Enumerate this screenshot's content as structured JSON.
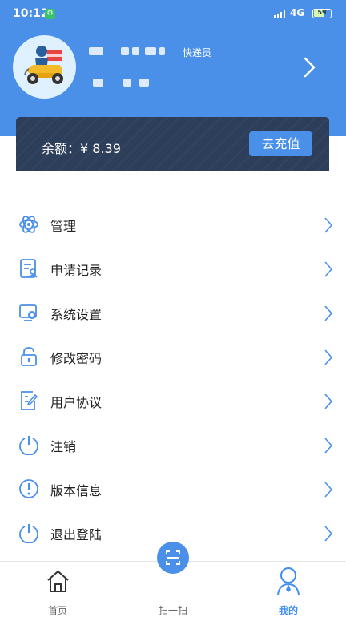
{
  "status_bar": {
    "time": "10:12",
    "app_badge": "⚙",
    "network": "4G",
    "battery": "59"
  },
  "profile": {
    "role": "快递员"
  },
  "balance": {
    "label": "余额：¥ 8.39",
    "recharge_label": "去充值"
  },
  "menu": [
    {
      "label": "管理",
      "icon": "atom-icon"
    },
    {
      "label": "申请记录",
      "icon": "document-user-icon"
    },
    {
      "label": "系统设置",
      "icon": "settings-icon"
    },
    {
      "label": "修改密码",
      "icon": "lock-icon"
    },
    {
      "label": "用户协议",
      "icon": "agreement-edit-icon"
    },
    {
      "label": "注销",
      "icon": "power-icon"
    },
    {
      "label": "版本信息",
      "icon": "info-icon"
    },
    {
      "label": "退出登陆",
      "icon": "logout-power-icon"
    }
  ],
  "nav": {
    "home": "首页",
    "scan": "扫一扫",
    "me": "我的"
  },
  "colors": {
    "primary": "#4a90e8",
    "card": "#2d3e5a",
    "icon": "#4a90e8"
  }
}
